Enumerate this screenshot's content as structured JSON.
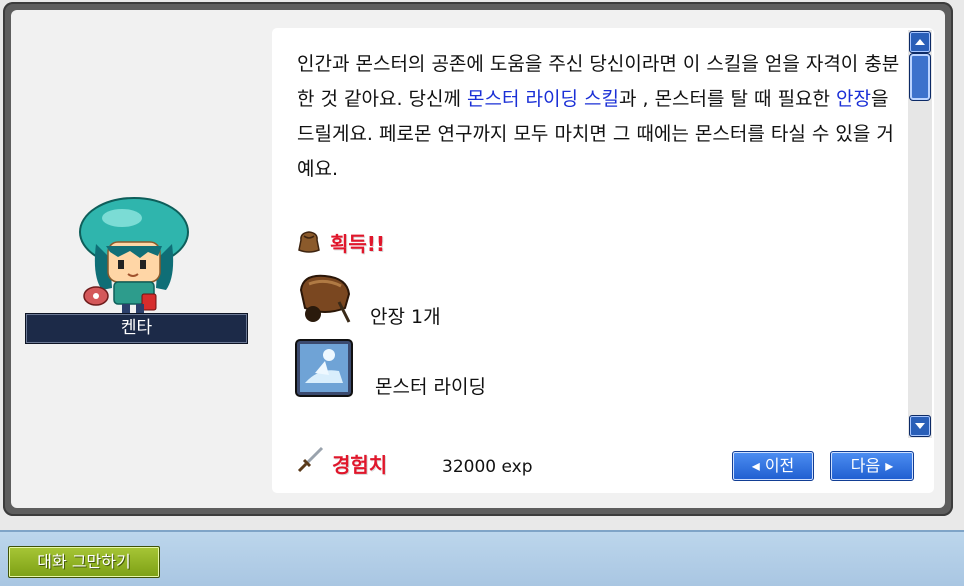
{
  "npc": {
    "name": "켄타"
  },
  "dialog": {
    "message": {
      "p1": "인간과 몬스터의 공존에 도움을 주신 당신이라면 이 스킬을 얻을 자격이 충분한 것 같아요. 당신께 ",
      "h1": "몬스터 라이딩 스킬",
      "p2": "과 , 몬스터를 탈 때 필요한 ",
      "h2": "안장",
      "p3": "을 드릴게요. 페로몬 연구까지 모두 마치면 그 때에는 몬스터를 타실 수 있을 거예요."
    },
    "reward_header": "획득!!",
    "rewards": [
      {
        "label": "안장 1개",
        "icon": "saddle-icon"
      },
      {
        "label": "몬스터 라이딩",
        "icon": "monster-riding-skill-icon"
      }
    ],
    "exp_header": "경험치",
    "exp_value": "32000 exp",
    "prev_label": "◂ 이전",
    "next_label": "다음 ▸"
  },
  "bottom_bar": {
    "end_chat_label": "대화 그만하기"
  },
  "colors": {
    "highlight": "#1a2fd6",
    "section_header": "#e0162b",
    "nav_button": "#2a6ae0",
    "end_chat_button": "#8cae22"
  }
}
